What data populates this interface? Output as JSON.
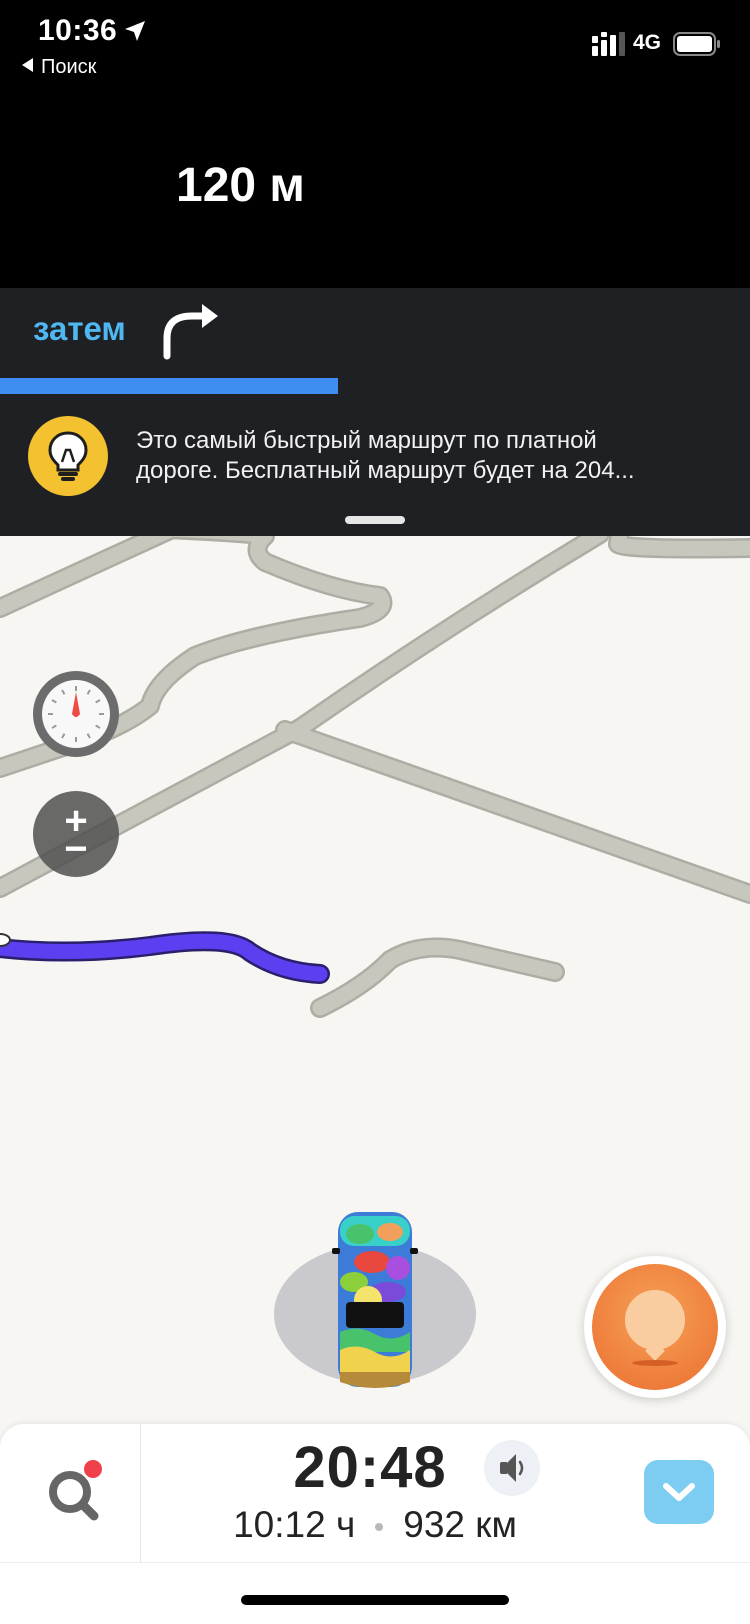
{
  "status_bar": {
    "time": "10:36",
    "back_label": "Поиск",
    "network": "4G"
  },
  "navigation": {
    "distance": "120 м",
    "then_label": "затем",
    "then_turn": "right-turn-arrow-icon",
    "progress_fraction": 0.45
  },
  "tip": {
    "icon": "lightbulb-icon",
    "line1": "Это самый быстрый маршрут по платной",
    "line2": "дороге. Бесплатный маршрут будет на 204..."
  },
  "map": {
    "route_color": "#5b3ff0",
    "road_color": "#c8c7bd"
  },
  "bottom_bar": {
    "eta": "20:48",
    "duration": "10:12 ч",
    "distance": "932 км"
  },
  "colors": {
    "accent_blue": "#3d8ef0",
    "then_text": "#4fb8f0",
    "tip_yellow": "#f4c230",
    "report_orange": "#ee7d3b",
    "notification_red": "#f0414b",
    "chevron_button": "#7ccdf1"
  }
}
